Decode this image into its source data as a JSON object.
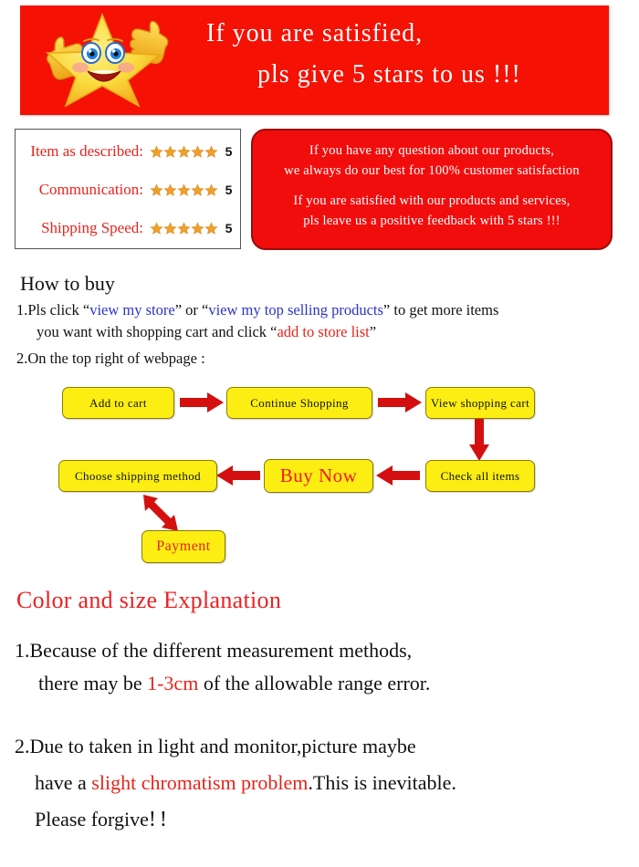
{
  "banner": {
    "line1": "If you are satisfied,",
    "line2": "pls give 5 stars to us !!!",
    "background_color": "#f51104",
    "text_color": "#ffffff",
    "mascot_icon": "smiling-star-thumbs-up-icon"
  },
  "ratings": {
    "border_color": "#555555",
    "star_color": "#f0a028",
    "label_color": "#e8231b",
    "rows": [
      {
        "label": "Item as described:",
        "stars": 5,
        "score": "5"
      },
      {
        "label": "Communication:",
        "stars": 5,
        "score": "5"
      },
      {
        "label": "Shipping Speed:",
        "stars": 5,
        "score": "5"
      }
    ]
  },
  "message_box": {
    "background_color": "#f20d0d",
    "border_color": "#9c0c0c",
    "line1": "If you have any question about our products,",
    "line2": "we always do our best for 100% customer satisfaction",
    "line3": "If you are satisfied with our products and services,",
    "line4": "pls leave us a positive feedback with 5 stars !!!"
  },
  "how_to_buy": {
    "title": "How to buy",
    "step1": {
      "prefix": "1.Pls click “",
      "link1": "view my store",
      "mid1": "” or “",
      "link2": "view my top selling products",
      "mid2": "” to get more items",
      "line2_prefix": "you want with shopping cart and click “",
      "line2_red": "add to store list",
      "line2_suffix": "”"
    },
    "step2": "2.On the top right of webpage :"
  },
  "flowchart": {
    "box_fill": "#fcee13",
    "box_border": "#8a7c00",
    "arrow_color": "#d40f0f",
    "boxes": [
      {
        "id": "add-to-cart",
        "label": "Add to cart"
      },
      {
        "id": "continue-shopping",
        "label": "Continue Shopping"
      },
      {
        "id": "view-shopping-cart",
        "label": "View shopping cart"
      },
      {
        "id": "check-all-items",
        "label": "Check all items"
      },
      {
        "id": "buy-now",
        "label": "Buy Now"
      },
      {
        "id": "choose-shipping-method",
        "label": "Choose shipping method"
      },
      {
        "id": "payment",
        "label": "Payment"
      }
    ]
  },
  "color_size": {
    "title": "Color and size Explanation",
    "title_color": "#ee2020",
    "item1": {
      "line1": "1.Because of the different measurement methods,",
      "line2_prefix": "there may be ",
      "line2_red": "1-3cm",
      "line2_suffix": " of the allowable range error."
    },
    "item2": {
      "line1": "2.Due to taken in light and monitor,picture maybe",
      "line2_prefix": "have a ",
      "line2_red": "slight chromatism problem",
      "line2_suffix": ".This is inevitable.",
      "line3": "Please forgive",
      "line3_bang": "!!"
    }
  }
}
